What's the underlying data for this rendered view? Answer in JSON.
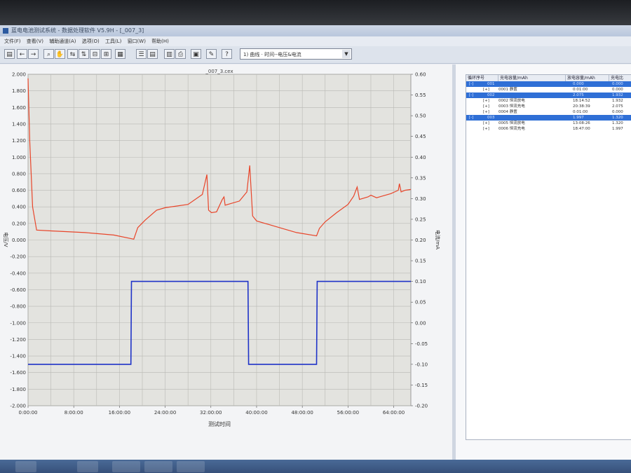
{
  "window": {
    "title": "蓝电电池测试系统 - 数据处理软件 V5.9H - [_007_3]"
  },
  "menu": [
    "文件(F)",
    "查看(V)",
    "辅助通道(A)",
    "选项(O)",
    "工具(L)",
    "窗口(W)",
    "帮助(H)"
  ],
  "toolbar": {
    "view_select": "1) 曲线 · 时间--电压&电流"
  },
  "chart": {
    "file_title": "_007_3.cex",
    "y_left_label": "电压/V",
    "y_right_label": "电流/mA",
    "x_label": "测试时间"
  },
  "chart_data": {
    "type": "line",
    "title": "_007_3.cex",
    "xlabel": "测试时间",
    "ylabel": "电压/V",
    "y2label": "电流/mA",
    "ylim": [
      -2.0,
      2.0
    ],
    "y2lim": [
      -0.2,
      0.6
    ],
    "xlim": [
      0,
      67
    ],
    "x_ticks": [
      "0:00:00",
      "8:00:00",
      "16:00:00",
      "24:00:00",
      "32:00:00",
      "40:00:00",
      "48:00:00",
      "56:00:00",
      "64:00:00"
    ],
    "y_ticks": [
      "2.000",
      "1.800",
      "1.600",
      "1.400",
      "1.200",
      "1.000",
      "0.800",
      "0.600",
      "0.400",
      "0.200",
      "0.000",
      "-0.200",
      "-0.400",
      "-0.600",
      "-0.800",
      "-1.000",
      "-1.200",
      "-1.400",
      "-1.600",
      "-1.800",
      "-2.000"
    ],
    "y2_ticks": [
      "0.60",
      "0.55",
      "0.50",
      "0.45",
      "0.40",
      "0.35",
      "0.30",
      "0.25",
      "0.20",
      "0.15",
      "0.10",
      "0.05",
      "0.00",
      "-0.05",
      "-0.10",
      "-0.15",
      "-0.20"
    ],
    "grid": true,
    "series": [
      {
        "axis": "left",
        "color": "#e8452a",
        "points": [
          [
            0,
            1.95
          ],
          [
            0.3,
            1.2
          ],
          [
            0.8,
            0.4
          ],
          [
            1.5,
            0.12
          ],
          [
            4,
            0.11
          ],
          [
            10,
            0.09
          ],
          [
            15,
            0.06
          ],
          [
            18.5,
            0.01
          ],
          [
            19.2,
            0.15
          ],
          [
            20.5,
            0.24
          ],
          [
            22.5,
            0.36
          ],
          [
            24,
            0.39
          ],
          [
            28,
            0.43
          ],
          [
            30.5,
            0.55
          ],
          [
            31.3,
            0.79
          ],
          [
            31.6,
            0.36
          ],
          [
            32.1,
            0.33
          ],
          [
            33,
            0.34
          ],
          [
            34,
            0.49
          ],
          [
            34.3,
            0.52
          ],
          [
            34.5,
            0.42
          ],
          [
            37,
            0.47
          ],
          [
            38.3,
            0.58
          ],
          [
            38.8,
            0.9
          ],
          [
            39.3,
            0.29
          ],
          [
            40,
            0.23
          ],
          [
            43,
            0.17
          ],
          [
            47,
            0.09
          ],
          [
            50.5,
            0.05
          ],
          [
            51,
            0.14
          ],
          [
            52,
            0.22
          ],
          [
            54,
            0.33
          ],
          [
            56,
            0.43
          ],
          [
            57,
            0.53
          ],
          [
            57.6,
            0.64
          ],
          [
            58,
            0.49
          ],
          [
            59.5,
            0.52
          ],
          [
            60,
            0.54
          ],
          [
            61,
            0.51
          ],
          [
            62,
            0.53
          ],
          [
            63.5,
            0.56
          ],
          [
            64.8,
            0.6
          ],
          [
            65,
            0.68
          ],
          [
            65.3,
            0.58
          ],
          [
            66,
            0.6
          ],
          [
            67,
            0.61
          ]
        ]
      },
      {
        "axis": "right",
        "color": "#1f33c8",
        "points": [
          [
            0,
            -0.1
          ],
          [
            18,
            -0.1
          ],
          [
            18.1,
            0.1
          ],
          [
            38.5,
            0.1
          ],
          [
            38.6,
            -0.1
          ],
          [
            50.5,
            -0.1
          ],
          [
            50.6,
            0.1
          ],
          [
            67,
            0.1
          ]
        ]
      }
    ]
  },
  "table": {
    "headers": [
      "循环序号",
      "充电容量/mAh",
      "放电容量/mAh",
      "充电比"
    ],
    "rows": [
      {
        "group": true,
        "c1": "[-]",
        "c2": "001",
        "c3": "0.000",
        "c4": "0.000"
      },
      {
        "group": false,
        "c1": "[+]",
        "c2": "0001 静置",
        "c3": "0:01:00",
        "c4": "0.000"
      },
      {
        "group": true,
        "c1": "[-]",
        "c2": "002",
        "c3": "2.075",
        "c4": "1.932"
      },
      {
        "group": false,
        "c1": "[+]",
        "c2": "0002 恒流放电",
        "c3": "18:14:52",
        "c4": "1.932"
      },
      {
        "group": false,
        "c1": "[+]",
        "c2": "0003 恒流充电",
        "c3": "20:38:39",
        "c4": "2.075"
      },
      {
        "group": false,
        "c1": "[+]",
        "c2": "0004 静置",
        "c3": "0:01:00",
        "c4": "0.000"
      },
      {
        "group": true,
        "c1": "[-]",
        "c2": "003",
        "c3": "1.997",
        "c4": "1.320"
      },
      {
        "group": false,
        "c1": "[+]",
        "c2": "0005 恒流放电",
        "c3": "13:08:26",
        "c4": "1.320"
      },
      {
        "group": false,
        "c1": "[+]",
        "c2": "0006 恒流充电",
        "c3": "18:47:00",
        "c4": "1.997"
      }
    ]
  },
  "colors": {
    "voltage_line": "#e8452a",
    "current_line": "#1f33c8",
    "plot_bg": "#e3e3df",
    "selected_row": "#2f6fd6"
  }
}
